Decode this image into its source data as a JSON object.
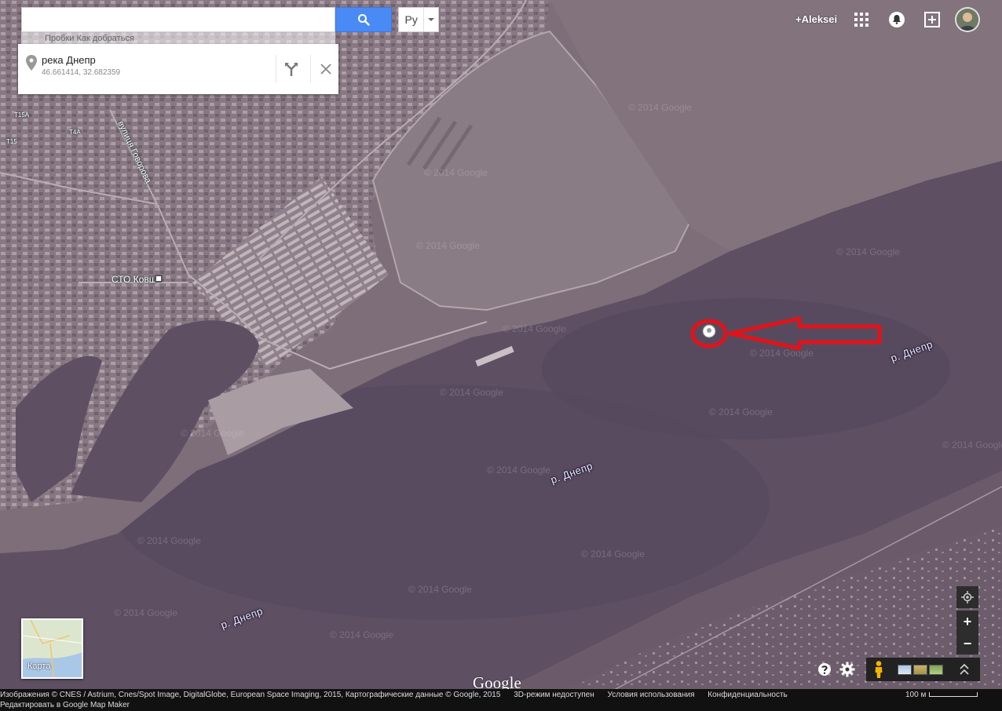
{
  "search": {
    "value": "",
    "placeholder": ""
  },
  "language_button": {
    "label": "Ру"
  },
  "hint_strip": {
    "text": "Пробки  Как добраться"
  },
  "place_card": {
    "title": "река Днепр",
    "coordinates": "46.661414, 32.682359",
    "directions_icon": "directions-icon",
    "close_icon": "close-icon"
  },
  "top_right": {
    "user_link": "+Aleksei",
    "apps_icon": "apps-grid-icon",
    "notifications_icon": "bell-icon",
    "share_icon": "share-icon",
    "avatar": "user-avatar"
  },
  "map": {
    "labels": {
      "street": "вулиця Говорова",
      "poi": "СТО Ковш",
      "river_1": "р. Днепр",
      "river_2": "р. Днепр",
      "river_3": "р. Днепр",
      "road_a": "Т15А",
      "road_b": "Т15",
      "road_c": "Т4А"
    },
    "watermark": "© 2014 Google",
    "annotation": {
      "color": "#e0131b"
    }
  },
  "minimap": {
    "label": "Карта"
  },
  "controls": {
    "zoom_in": "+",
    "zoom_out": "−"
  },
  "layers": {
    "pegman": "pegman-icon",
    "expand_icon": "chevron-up-icon"
  },
  "logo": "Google",
  "footer": {
    "attribution": "Изображения © CNES / Astrium, Cnes/Spot Image, DigitalGlobe, European Space Imaging, 2015, Картографические данные © Google, 2015",
    "mode_3d": "3D-режим недоступен",
    "terms": "Условия использования",
    "privacy": "Конфиденциальность",
    "edit_link": "Редактировать в Google Map Maker",
    "scale": "100 м"
  },
  "colors": {
    "accent_blue": "#4a8af4",
    "annotation_red": "#e0131b",
    "water": "#5e4f63"
  }
}
